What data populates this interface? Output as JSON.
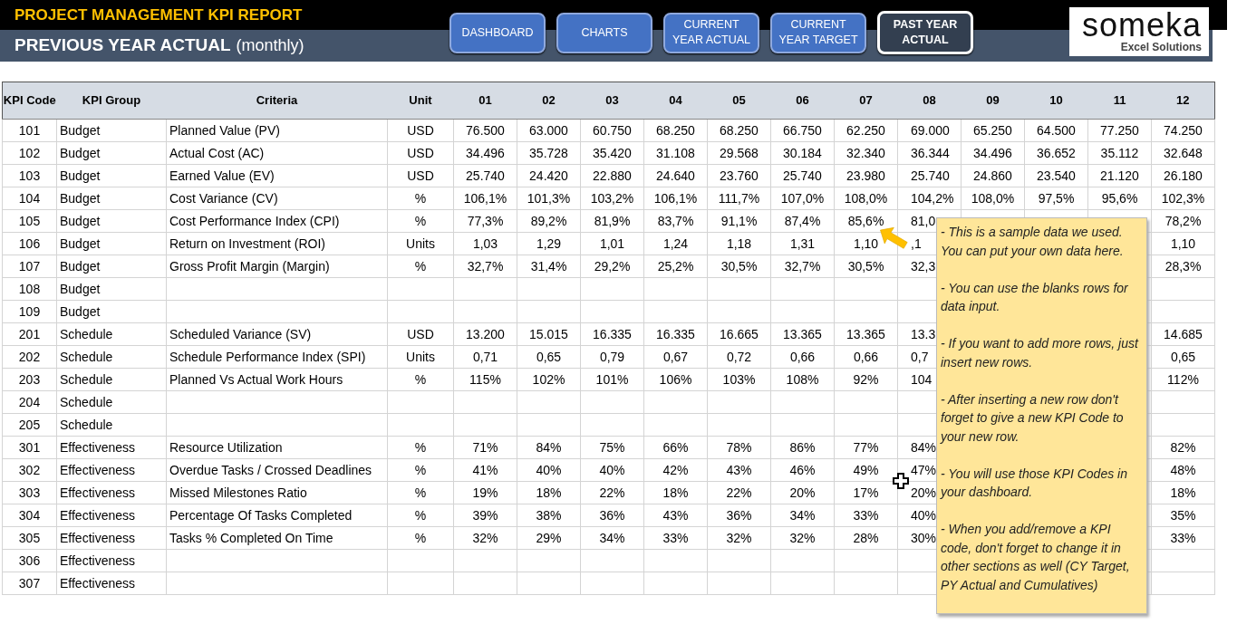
{
  "header": {
    "title": "PROJECT MANAGEMENT KPI REPORT",
    "subtitle": "PREVIOUS YEAR ACTUAL",
    "subtitle_note": "(monthly)",
    "nav": [
      {
        "label": "DASHBOARD",
        "selected": false
      },
      {
        "label": "CHARTS",
        "selected": false
      },
      {
        "label": "CURRENT YEAR ACTUAL",
        "selected": false
      },
      {
        "label": "CURRENT YEAR TARGET",
        "selected": false
      },
      {
        "label": "PAST YEAR ACTUAL",
        "selected": true
      }
    ],
    "logo": {
      "name": "someka",
      "tagline": "Excel Solutions"
    }
  },
  "table": {
    "columns": [
      "KPI Code",
      "KPI Group",
      "Criteria",
      "Unit",
      "01",
      "02",
      "03",
      "04",
      "05",
      "06",
      "07",
      "08",
      "09",
      "10",
      "11",
      "12"
    ],
    "rows": [
      {
        "code": "101",
        "group": "Budget",
        "criteria": "Planned Value (PV)",
        "unit": "USD",
        "values": [
          "76.500",
          "63.000",
          "60.750",
          "68.250",
          "68.250",
          "66.750",
          "62.250",
          "69.000",
          "65.250",
          "64.500",
          "77.250",
          "74.250"
        ]
      },
      {
        "code": "102",
        "group": "Budget",
        "criteria": "Actual Cost (AC)",
        "unit": "USD",
        "values": [
          "34.496",
          "35.728",
          "35.420",
          "31.108",
          "29.568",
          "30.184",
          "32.340",
          "36.344",
          "34.496",
          "36.652",
          "35.112",
          "32.648"
        ]
      },
      {
        "code": "103",
        "group": "Budget",
        "criteria": "Earned Value (EV)",
        "unit": "USD",
        "values": [
          "25.740",
          "24.420",
          "22.880",
          "24.640",
          "23.760",
          "25.740",
          "23.980",
          "25.740",
          "24.860",
          "23.540",
          "21.120",
          "26.180"
        ]
      },
      {
        "code": "104",
        "group": "Budget",
        "criteria": "Cost Variance (CV)",
        "unit": "%",
        "values": [
          "106,1%",
          "101,3%",
          "103,2%",
          "106,1%",
          "111,7%",
          "107,0%",
          "108,0%",
          "104,2%",
          "108,0%",
          "97,5%",
          "95,6%",
          "102,3%"
        ]
      },
      {
        "code": "105",
        "group": "Budget",
        "criteria": "Cost Performance Index (CPI)",
        "unit": "%",
        "values": [
          "77,3%",
          "89,2%",
          "81,9%",
          "83,7%",
          "91,1%",
          "87,4%",
          "85,6%",
          "81,0"
        ],
        "last_value": "78,2%"
      },
      {
        "code": "106",
        "group": "Budget",
        "criteria": "Return on Investment (ROI)",
        "unit": "Units",
        "values": [
          "1,03",
          "1,29",
          "1,01",
          "1,24",
          "1,18",
          "1,31",
          "1,10",
          ",1"
        ],
        "last_value": "1,10"
      },
      {
        "code": "107",
        "group": "Budget",
        "criteria": "Gross Profit Margin (Margin)",
        "unit": "%",
        "values": [
          "32,7%",
          "31,4%",
          "29,2%",
          "25,2%",
          "30,5%",
          "32,7%",
          "30,5%",
          "32,3"
        ],
        "last_value": "28,3%"
      },
      {
        "code": "108",
        "group": "Budget"
      },
      {
        "code": "109",
        "group": "Budget"
      },
      {
        "code": "201",
        "group": "Schedule",
        "criteria": "Scheduled Variance (SV)",
        "unit": "USD",
        "values": [
          "13.200",
          "15.015",
          "16.335",
          "16.335",
          "16.665",
          "13.365",
          "13.365",
          "13.3"
        ],
        "last_value": "14.685"
      },
      {
        "code": "202",
        "group": "Schedule",
        "criteria": "Schedule Performance Index (SPI)",
        "unit": "Units",
        "values": [
          "0,71",
          "0,65",
          "0,79",
          "0,67",
          "0,72",
          "0,66",
          "0,66",
          "0,7"
        ],
        "last_value": "0,65"
      },
      {
        "code": "203",
        "group": "Schedule",
        "criteria": "Planned Vs Actual Work Hours",
        "unit": "%",
        "values": [
          "115%",
          "102%",
          "101%",
          "106%",
          "103%",
          "108%",
          "92%",
          "104"
        ],
        "last_value": "112%"
      },
      {
        "code": "204",
        "group": "Schedule"
      },
      {
        "code": "205",
        "group": "Schedule"
      },
      {
        "code": "301",
        "group": "Effectiveness",
        "criteria": "Resource Utilization",
        "unit": "%",
        "values": [
          "71%",
          "84%",
          "75%",
          "66%",
          "78%",
          "86%",
          "77%",
          "84%"
        ],
        "last_value": "82%"
      },
      {
        "code": "302",
        "group": "Effectiveness",
        "criteria": "Overdue Tasks / Crossed Deadlines",
        "unit": "%",
        "values": [
          "41%",
          "40%",
          "40%",
          "42%",
          "43%",
          "46%",
          "49%",
          "47%"
        ],
        "last_value": "48%"
      },
      {
        "code": "303",
        "group": "Effectiveness",
        "criteria": "Missed Milestones Ratio",
        "unit": "%",
        "values": [
          "19%",
          "18%",
          "22%",
          "18%",
          "22%",
          "20%",
          "17%",
          "20%"
        ],
        "last_value": "18%"
      },
      {
        "code": "304",
        "group": "Effectiveness",
        "criteria": "Percentage Of Tasks Completed",
        "unit": "%",
        "values": [
          "39%",
          "38%",
          "36%",
          "43%",
          "36%",
          "34%",
          "33%",
          "40%"
        ],
        "last_value": "35%"
      },
      {
        "code": "305",
        "group": "Effectiveness",
        "criteria": "Tasks % Completed On Time",
        "unit": "%",
        "values": [
          "32%",
          "29%",
          "34%",
          "33%",
          "32%",
          "32%",
          "28%",
          "30%"
        ],
        "last_value": "33%"
      },
      {
        "code": "306",
        "group": "Effectiveness"
      },
      {
        "code": "307",
        "group": "Effectiveness"
      }
    ]
  },
  "note": {
    "paragraphs": [
      "- This is a sample data we used. You can put your own data here.",
      "- You can use the blanks rows for data input.",
      "- If you want to add more rows, just insert new rows.",
      "- After inserting a new row don't forget to give a new KPI Code to your new row.",
      "- You will use those KPI Codes in your dashboard.",
      "- When you add/remove a KPI code, don't forget to change it in other sections as well (CY Target, PY Actual and Cumulatives)"
    ]
  }
}
